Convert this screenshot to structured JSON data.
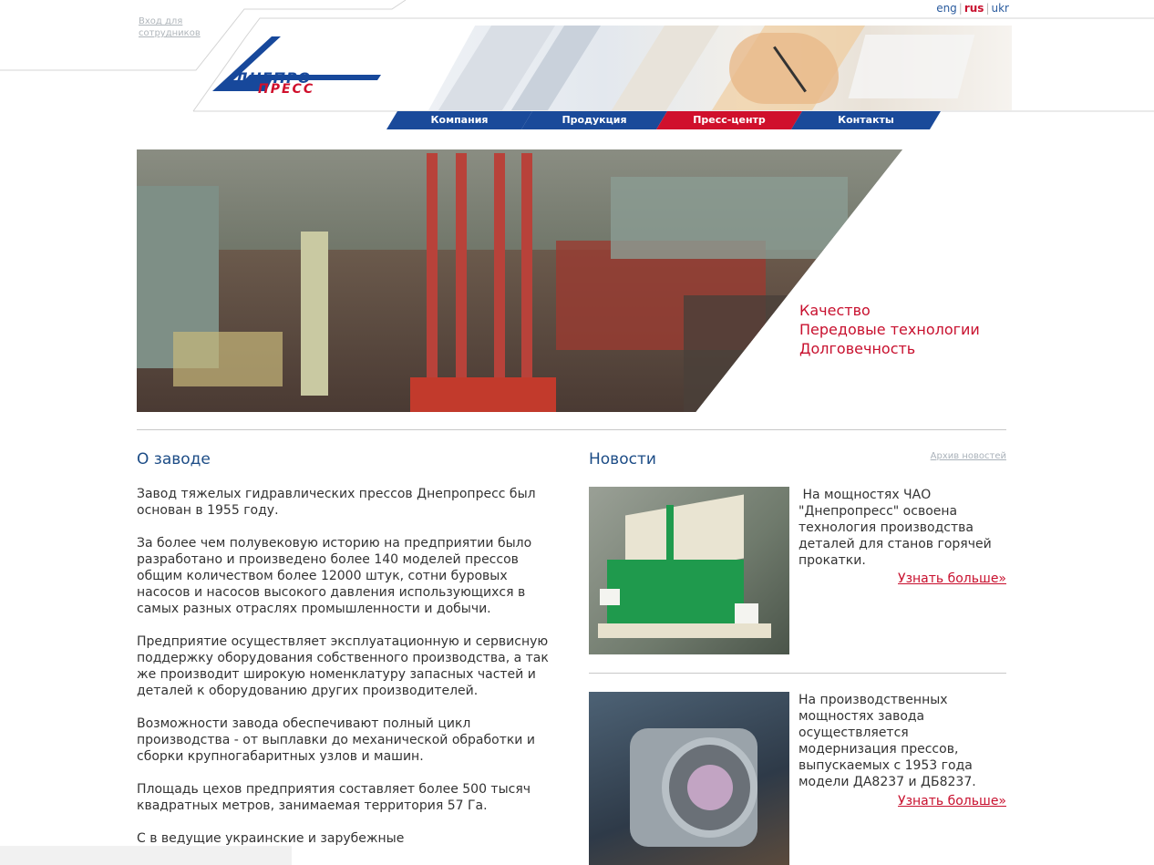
{
  "header": {
    "staff_login": "Вход для сотрудников",
    "logo_top": "ДНЕПРО",
    "logo_bottom": "ПРЕСС",
    "languages": [
      "eng",
      "rus",
      "ukr"
    ],
    "active_language": "rus",
    "nav": [
      {
        "label": "Компания",
        "color": "#1a4a9a"
      },
      {
        "label": "Продукция",
        "color": "#1a4a9a"
      },
      {
        "label": "Пресс-центр",
        "color": "#d0102c"
      },
      {
        "label": "Контакты",
        "color": "#1a4a9a"
      }
    ]
  },
  "hero": {
    "slogan": [
      "Качество",
      "Передовые технологии",
      "Долговечность"
    ]
  },
  "about": {
    "title": "О заводе",
    "paragraphs": [
      "Завод тяжелых гидравлических прессов Днепропресс был основан в 1955 году.",
      "За более чем полувековую историю на предприятии было разработано и произведено более 140 моделей прессов общим количеством более 12000 штук, сотни буровых насосов и насосов высокого давления использующихся в самых разных отраслях промышленности и добычи.",
      "Предприятие осуществляет эксплуатационную и сервисную поддержку оборудования собственного производства, а так же производит широкую номенклатуру запасных частей и деталей к оборудованию других производителей.",
      "Возможности завода обеспечивают полный цикл производства - от выплавки до механической обработки и сборки крупногабаритных узлов и машин.",
      "Площадь цехов предприятия составляет более 500 тысяч квадратных метров, занимаемая территория 57 Га.",
      "С                       в ведущие украинские и зарубежные"
    ]
  },
  "news": {
    "title": "Новости",
    "archive": "Архив новостей",
    "items": [
      {
        "text": " На мощностях ЧАО \"Днепропресс\" освоена технология производства деталей для станов горячей прокатки.",
        "more": "Узнать больше»"
      },
      {
        "text": "На производственных мощностях завода осуществляется модернизация прессов, выпускаемых с 1953 года модели ДА8237 и ДБ8237.",
        "more": "Узнать больше»"
      }
    ]
  },
  "colors": {
    "brand_blue": "#1a4a9a",
    "brand_red": "#d0102c",
    "heading": "#1c4c86"
  }
}
